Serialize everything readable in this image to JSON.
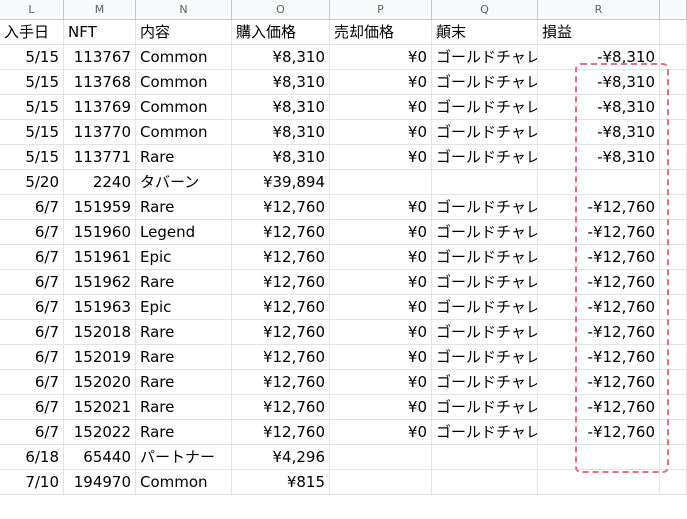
{
  "columns": [
    "L",
    "M",
    "N",
    "O",
    "P",
    "Q",
    "R"
  ],
  "header_row": [
    "入手日",
    "NFT",
    "内容",
    "購入価格",
    "売却価格",
    "顛末",
    "損益"
  ],
  "rows": [
    [
      "5/15",
      "113767",
      "Common",
      "¥8,310",
      "¥0",
      "ゴールドチャレ",
      "-¥8,310"
    ],
    [
      "5/15",
      "113768",
      "Common",
      "¥8,310",
      "¥0",
      "ゴールドチャレ",
      "-¥8,310"
    ],
    [
      "5/15",
      "113769",
      "Common",
      "¥8,310",
      "¥0",
      "ゴールドチャレ",
      "-¥8,310"
    ],
    [
      "5/15",
      "113770",
      "Common",
      "¥8,310",
      "¥0",
      "ゴールドチャレ",
      "-¥8,310"
    ],
    [
      "5/15",
      "113771",
      "Rare",
      "¥8,310",
      "¥0",
      "ゴールドチャレ",
      "-¥8,310"
    ],
    [
      "5/20",
      "2240",
      "タバーン",
      "¥39,894",
      "",
      "",
      ""
    ],
    [
      "6/7",
      "151959",
      "Rare",
      "¥12,760",
      "¥0",
      "ゴールドチャレ",
      "-¥12,760"
    ],
    [
      "6/7",
      "151960",
      "Legend",
      "¥12,760",
      "¥0",
      "ゴールドチャレ",
      "-¥12,760"
    ],
    [
      "6/7",
      "151961",
      "Epic",
      "¥12,760",
      "¥0",
      "ゴールドチャレ",
      "-¥12,760"
    ],
    [
      "6/7",
      "151962",
      "Rare",
      "¥12,760",
      "¥0",
      "ゴールドチャレ",
      "-¥12,760"
    ],
    [
      "6/7",
      "151963",
      "Epic",
      "¥12,760",
      "¥0",
      "ゴールドチャレ",
      "-¥12,760"
    ],
    [
      "6/7",
      "152018",
      "Rare",
      "¥12,760",
      "¥0",
      "ゴールドチャレ",
      "-¥12,760"
    ],
    [
      "6/7",
      "152019",
      "Rare",
      "¥12,760",
      "¥0",
      "ゴールドチャレ",
      "-¥12,760"
    ],
    [
      "6/7",
      "152020",
      "Rare",
      "¥12,760",
      "¥0",
      "ゴールドチャレ",
      "-¥12,760"
    ],
    [
      "6/7",
      "152021",
      "Rare",
      "¥12,760",
      "¥0",
      "ゴールドチャレ",
      "-¥12,760"
    ],
    [
      "6/7",
      "152022",
      "Rare",
      "¥12,760",
      "¥0",
      "ゴールドチャレ",
      "-¥12,760"
    ],
    [
      "6/18",
      "65440",
      "パートナー",
      "¥4,296",
      "",
      "",
      ""
    ],
    [
      "7/10",
      "194970",
      "Common",
      "¥815",
      "",
      "",
      ""
    ]
  ],
  "colors": {
    "highlight": "#e8707a",
    "header_bg": "#f8f9fa",
    "gridline": "#e2e3e3"
  }
}
